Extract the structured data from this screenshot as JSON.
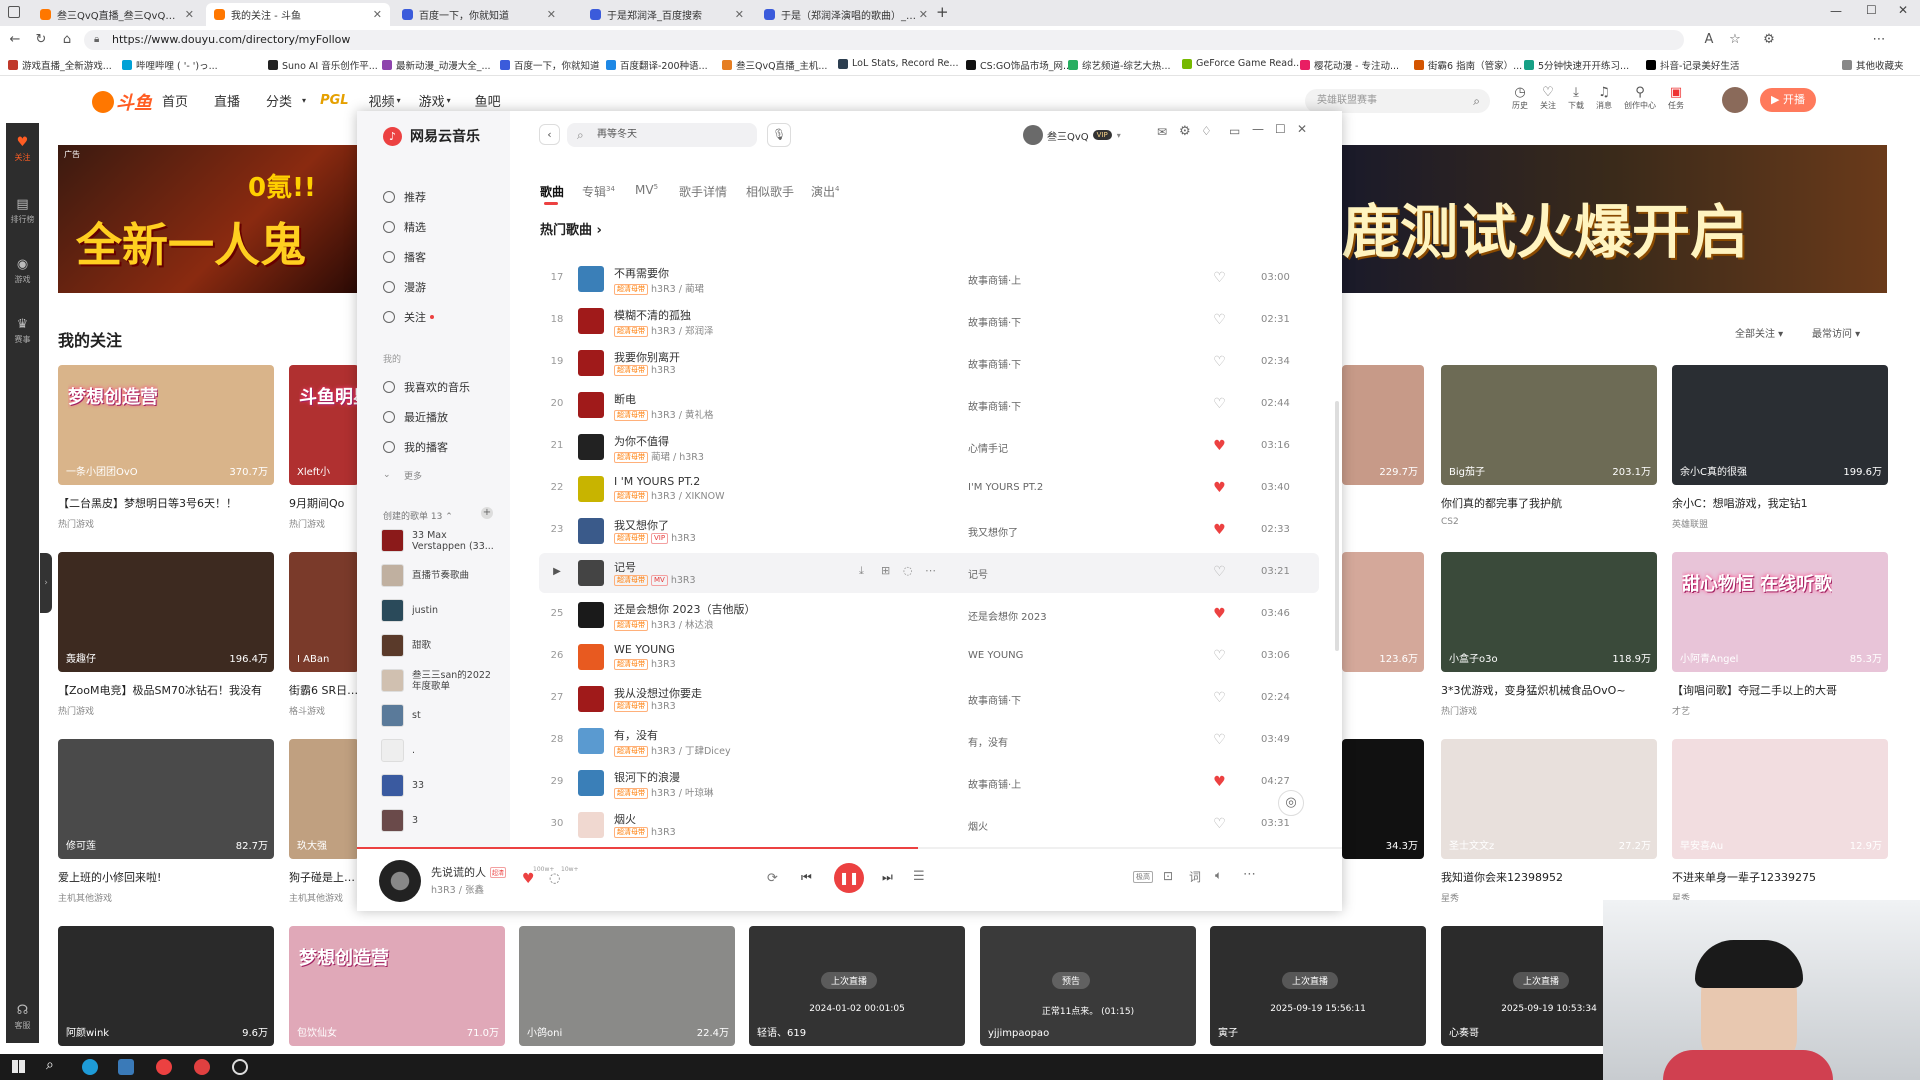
{
  "browser": {
    "tabs": [
      {
        "label": "叁三QvQ直播_叁三QvQ直播_叁三"
      },
      {
        "label": "我的关注 - 斗鱼"
      },
      {
        "label": "百度一下，你就知道"
      },
      {
        "label": "于是郑润泽_百度搜索"
      },
      {
        "label": "于是（郑润泽演唱的歌曲）_百度"
      }
    ],
    "url": "https://www.douyu.com/directory/myFollow",
    "bookmarks": [
      "游戏直播_全新游戏...",
      "哔哩哔哩 ( '- ')っ...",
      "Suno AI 音乐创作平...",
      "最新动漫_动漫大全_...",
      "百度一下，你就知道",
      "百度翻译-200种语...",
      "叁三QvQ直播_主机...",
      "LoL Stats, Record Re...",
      "CS:GO饰品市场_网...",
      "综艺频道-综艺大热...",
      "GeForce Game Read...",
      "樱花动漫 - 专注动...",
      "街霸6 指南（管家）...",
      "5分钟快速开开练习...",
      "抖音-记录美好生活",
      "其他收藏夹"
    ],
    "bookmark_colors": [
      "#c0392b",
      "#00a1d6",
      "#222222",
      "#8e44ad",
      "#3b5bdb",
      "#1e88e5",
      "#e67e22",
      "#2c3e50",
      "#111111",
      "#27ae60",
      "#76b900",
      "#e91e63",
      "#d35400",
      "#16a085",
      "#000000",
      "#888888"
    ]
  },
  "douyu": {
    "logo": "斗鱼",
    "logo_sub": "douyu.com",
    "nav": [
      "首页",
      "直播",
      "分类",
      "PGL",
      "视频",
      "游戏",
      "鱼吧"
    ],
    "search_placeholder": "英雄联盟赛事",
    "header_icons": [
      "历史",
      "关注",
      "下载",
      "消息",
      "创作中心",
      "任务"
    ],
    "open_live": "开播",
    "sidebar": [
      "关注",
      "排行榜",
      "游戏",
      "赛事",
      "客服"
    ],
    "banner_left": "全新一人鬼",
    "banner_left_top": "0氪!!",
    "banner_ad": "广告",
    "banner_right": "鹿测试火爆开启",
    "section_title": "我的关注",
    "filter_all": "全部关注",
    "filter_recent": "最常访问",
    "cards": [
      {
        "streamer": "一条小团团OvO",
        "hot": "370.7万",
        "title": "【二台黑皮】梦想明日等3号6天！！",
        "cat": "热门游戏",
        "bg": "#d9b48a",
        "badge": "梦想创造营"
      },
      {
        "streamer": "Xleft小",
        "hot": "",
        "title": "9月期间Qo",
        "cat": "热门游戏",
        "bg": "#b03030",
        "badge": "斗鱼明星主 共赏PGL"
      },
      {
        "streamer": "",
        "hot": "229.7万",
        "title": "",
        "cat": "",
        "bg": "#c79a88",
        "badge": ""
      },
      {
        "streamer": "Big茄子",
        "hot": "203.1万",
        "title": "你们真的都完事了我护航",
        "cat": "CS2",
        "bg": "#6d6b55",
        "badge": ""
      },
      {
        "streamer": "余小C真的很强",
        "hot": "199.6万",
        "title": "余小C：想唱游戏，我定钻1",
        "cat": "英雄联盟",
        "bg": "#2a2e33",
        "badge": ""
      },
      {
        "streamer": "轰趣仔",
        "hot": "196.4万",
        "title": "【ZooM电竞】极品SM70冰钻石！我没有",
        "cat": "热门游戏",
        "bg": "#3d2a20",
        "badge": ""
      },
      {
        "streamer": "I ABan",
        "hot": "",
        "title": "街霸6 SR日本街",
        "cat": "格斗游戏",
        "bg": "#7a3a2a",
        "badge": ""
      },
      {
        "streamer": "",
        "hot": "123.6万",
        "title": "",
        "cat": "",
        "bg": "#d4a89a",
        "badge": ""
      },
      {
        "streamer": "小盒子o3o",
        "hot": "118.9万",
        "title": "3*3优游戏，变身猛炽机械食品OvO~",
        "cat": "热门游戏",
        "bg": "#3a4a3a",
        "badge": ""
      },
      {
        "streamer": "小阿青Angel",
        "hot": "85.3万",
        "title": "【询唱问歌】夺冠二手以上的大哥",
        "cat": "才艺",
        "bg": "#e8c4d8",
        "badge": "甜心物恒 在线听歌"
      },
      {
        "streamer": "修可莲",
        "hot": "82.7万",
        "title": "爱上班的小修回来啦!",
        "cat": "主机其他游戏",
        "bg": "#4a4a4a",
        "badge": ""
      },
      {
        "streamer": "玖大强",
        "hot": "",
        "title": "狗子碰是上班了",
        "cat": "主机其他游戏",
        "bg": "#c0a080",
        "badge": ""
      },
      {
        "streamer": "",
        "hot": "34.3万",
        "title": "",
        "cat": "",
        "bg": "#111111",
        "badge": ""
      },
      {
        "streamer": "圣士文文z",
        "hot": "27.2万",
        "title": "我知道你会来12398952",
        "cat": "星秀",
        "bg": "#e8e0dc",
        "badge": ""
      },
      {
        "streamer": "早安喜Au",
        "hot": "12.9万",
        "title": "不进来单身一辈子12339275",
        "cat": "星秀",
        "bg": "#f2dde0",
        "badge": ""
      },
      {
        "streamer": "阿颜wink",
        "hot": "9.6万",
        "title": "",
        "cat": "",
        "bg": "#2a2a2a",
        "badge": ""
      },
      {
        "streamer": "包饮仙女",
        "hot": "71.0万",
        "title": "",
        "cat": "",
        "bg": "#e0a8b8",
        "badge": "梦想创造营"
      },
      {
        "streamer": "小鸽oni",
        "hot": "22.4万",
        "title": "",
        "cat": "",
        "bg": "#8a8a88",
        "badge": ""
      },
      {
        "streamer": "轻语、619",
        "hot": "",
        "title": "",
        "cat": "",
        "bg": "#333333",
        "badge": "上次直播",
        "time": "2024-01-02 00:01:05"
      },
      {
        "streamer": "yjjimpaopao",
        "hot": "",
        "title": "",
        "cat": "",
        "bg": "#3a3a3a",
        "badge": "预告",
        "time": "正常11点来。 (01:15)"
      },
      {
        "streamer": "寅子",
        "hot": "",
        "title": "",
        "cat": "",
        "bg": "#2e2e2e",
        "badge": "上次直播",
        "time": "2025-09-19 15:56:11"
      },
      {
        "streamer": "心奏哥",
        "hot": "",
        "title": "",
        "cat": "",
        "bg": "#2b2b2b",
        "badge": "上次直播",
        "time": "2025-09-19 10:53:34"
      }
    ]
  },
  "netease": {
    "brand": "网易云音乐",
    "search_value": "再等冬天",
    "user": "叁三QvQ",
    "vip": "VIP",
    "nav": [
      {
        "label": "推荐"
      },
      {
        "label": "精选"
      },
      {
        "label": "播客"
      },
      {
        "label": "漫游"
      },
      {
        "label": "关注"
      }
    ],
    "mine_title": "我的",
    "mine": [
      {
        "label": "我喜欢的音乐"
      },
      {
        "label": "最近播放"
      },
      {
        "label": "我的播客"
      },
      {
        "label": "更多"
      }
    ],
    "created_title": "创建的歌单 13",
    "playlists": [
      {
        "name": "33 Max Verstappen (33...",
        "color": "#8b1a1a"
      },
      {
        "name": "直播节奏歌曲",
        "color": "#c0b0a0"
      },
      {
        "name": "justin",
        "color": "#2a4a5a"
      },
      {
        "name": "甜歌",
        "color": "#5a3a2a"
      },
      {
        "name": "叁三三san的2022年度歌单",
        "color": "#d0c0b0"
      },
      {
        "name": "st",
        "color": "#5a7a9a"
      },
      {
        "name": ".",
        "color": "#eeeeee"
      },
      {
        "name": "33",
        "color": "#3a5aa0"
      },
      {
        "name": "3",
        "color": "#6a4a4a"
      }
    ],
    "tabs": [
      {
        "label": "歌曲",
        "count": ""
      },
      {
        "label": "专辑",
        "count": "34"
      },
      {
        "label": "MV",
        "count": "5"
      },
      {
        "label": "歌手详情",
        "count": ""
      },
      {
        "label": "相似歌手",
        "count": ""
      },
      {
        "label": "演出",
        "count": "4"
      }
    ],
    "section": "热门歌曲",
    "songs": [
      {
        "idx": "17",
        "title": "不再需要你",
        "tags": [
          "超清母带"
        ],
        "artist": "h3R3 / 蔺珺",
        "album": "故事商铺·上",
        "liked": false,
        "dur": "03:00",
        "cover": "#3a7fb8"
      },
      {
        "idx": "18",
        "title": "模糊不清的孤独",
        "tags": [
          "超清母带"
        ],
        "artist": "h3R3 / 郑润泽",
        "album": "故事商铺·下",
        "liked": false,
        "dur": "02:31",
        "cover": "#a01a1a"
      },
      {
        "idx": "19",
        "title": "我要你别离开",
        "tags": [
          "超清母带"
        ],
        "artist": "h3R3",
        "album": "故事商铺·下",
        "liked": false,
        "dur": "02:34",
        "cover": "#a01a1a"
      },
      {
        "idx": "20",
        "title": "断电",
        "tags": [
          "超清母带"
        ],
        "artist": "h3R3 / 黄礼格",
        "album": "故事商铺·下",
        "liked": false,
        "dur": "02:44",
        "cover": "#a01a1a"
      },
      {
        "idx": "21",
        "title": "为你不值得",
        "tags": [
          "超清母带"
        ],
        "artist": "蔺珺 / h3R3",
        "album": "心情手记",
        "liked": true,
        "dur": "03:16",
        "cover": "#222222"
      },
      {
        "idx": "22",
        "title": "I 'M YOURS PT.2",
        "tags": [
          "超清母带"
        ],
        "artist": "h3R3 / XIKNOW",
        "album": "I'M YOURS PT.2",
        "liked": true,
        "dur": "03:40",
        "cover": "#c8b400"
      },
      {
        "idx": "23",
        "title": "我又想你了",
        "tags": [
          "超清母带",
          "VIP"
        ],
        "artist": "h3R3",
        "album": "我又想你了",
        "liked": true,
        "dur": "02:33",
        "cover": "#3a5a8a"
      },
      {
        "idx": "24",
        "title": "记号",
        "tags": [
          "超清母带",
          "MV"
        ],
        "artist": "h3R3",
        "album": "记号",
        "liked": false,
        "dur": "03:21",
        "cover": "#444444"
      },
      {
        "idx": "25",
        "title": "还是会想你 2023（吉他版）",
        "tags": [
          "超清母带"
        ],
        "artist": "h3R3 / 林达浪",
        "album": "还是会想你 2023",
        "liked": true,
        "dur": "03:46",
        "cover": "#1a1a1a"
      },
      {
        "idx": "26",
        "title": "WE YOUNG",
        "tags": [
          "超清母带"
        ],
        "artist": "h3R3",
        "album": "WE YOUNG",
        "liked": false,
        "dur": "03:06",
        "cover": "#e85a20"
      },
      {
        "idx": "27",
        "title": "我从没想过你要走",
        "tags": [
          "超清母带"
        ],
        "artist": "h3R3",
        "album": "故事商铺·下",
        "liked": false,
        "dur": "02:24",
        "cover": "#a01a1a"
      },
      {
        "idx": "28",
        "title": "有，没有",
        "tags": [
          "超清母带"
        ],
        "artist": "h3R3 / 丁肆Dicey",
        "album": "有，没有",
        "liked": false,
        "dur": "03:49",
        "cover": "#5a9ad0"
      },
      {
        "idx": "29",
        "title": "银河下的浪漫",
        "tags": [
          "超清母带"
        ],
        "artist": "h3R3 / 叶琼琳",
        "album": "故事商铺·上",
        "liked": true,
        "dur": "04:27",
        "cover": "#3a7fb8"
      },
      {
        "idx": "30",
        "title": "烟火",
        "tags": [
          "超清母带"
        ],
        "artist": "h3R3",
        "album": "烟火",
        "liked": false,
        "dur": "03:31",
        "cover": "#f0d8d0"
      }
    ],
    "player": {
      "title": "先说谎的人",
      "tag": "超清",
      "artist": "h3R3 / 张鑫",
      "like_count": "100w+",
      "comment_count": "10w+",
      "progress": 0.57,
      "quality": "极高"
    }
  },
  "accent": "#ec4141"
}
